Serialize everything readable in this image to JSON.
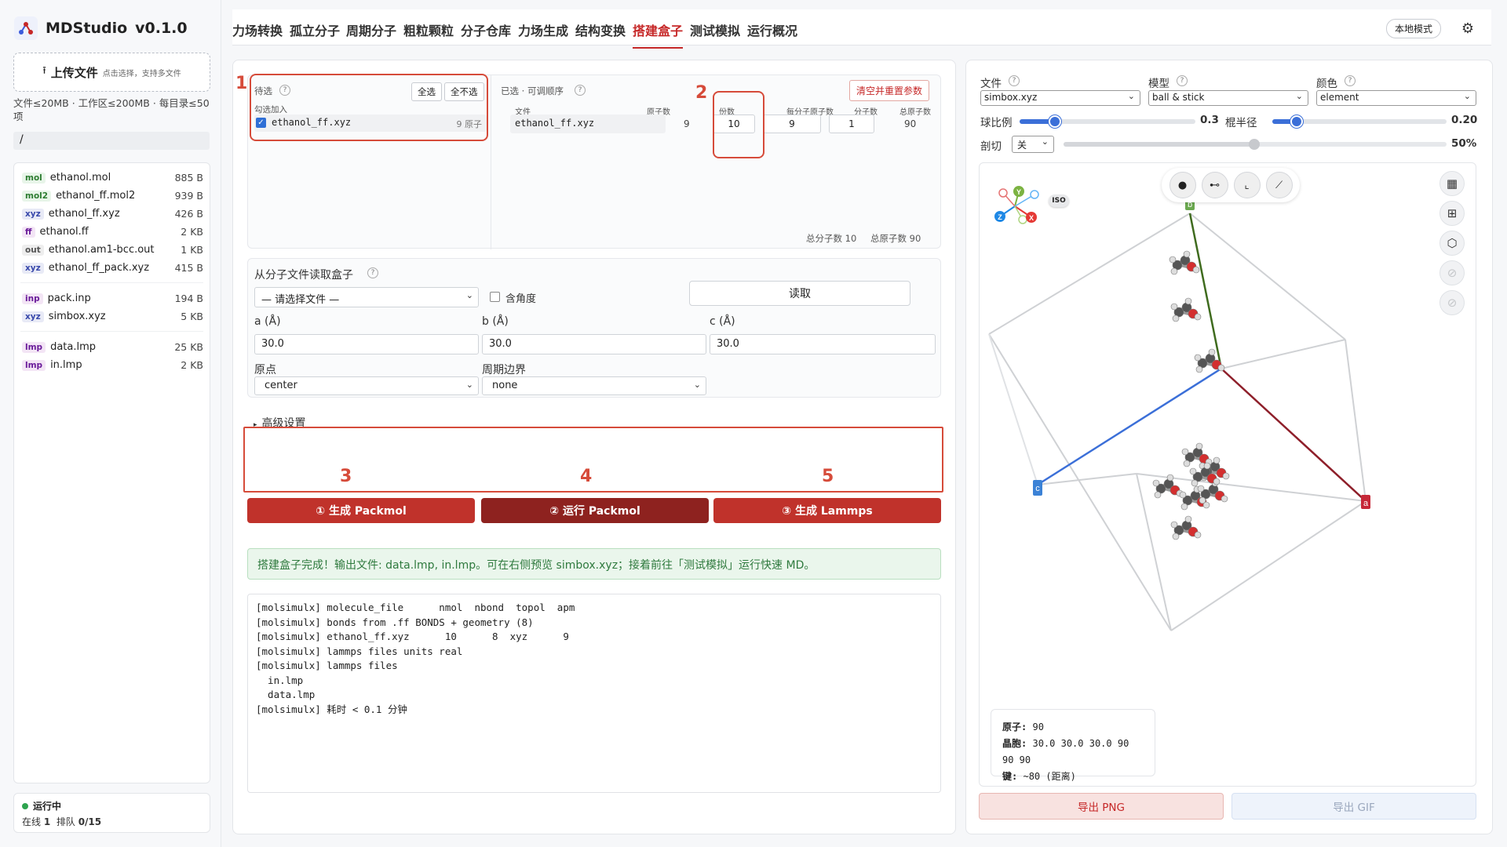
{
  "app": {
    "name": "MDStudio",
    "version": "v0.1.0"
  },
  "sidebar": {
    "upload_label": "上传文件",
    "upload_hint": "点击选择，支持多文件",
    "limits": "文件≤20MB · 工作区≤200MB · 每目录≤50项",
    "path": "/",
    "files": [
      {
        "tag": "mol",
        "name": "ethanol.mol",
        "size": "885 B",
        "color": "#2e7d32",
        "bg": "#e8f5e9"
      },
      {
        "tag": "mol2",
        "name": "ethanol_ff.mol2",
        "size": "939 B",
        "color": "#2e7d32",
        "bg": "#e8f5e9"
      },
      {
        "tag": "xyz",
        "name": "ethanol_ff.xyz",
        "size": "426 B",
        "color": "#3949ab",
        "bg": "#e8eaf6"
      },
      {
        "tag": "ff",
        "name": "ethanol.ff",
        "size": "2 KB",
        "color": "#6a1b9a",
        "bg": "#f3e5f5"
      },
      {
        "tag": "out",
        "name": "ethanol.am1-bcc.out",
        "size": "1 KB",
        "color": "#555555",
        "bg": "#eeeeee"
      },
      {
        "tag": "xyz",
        "name": "ethanol_ff_pack.xyz",
        "size": "415 B",
        "color": "#3949ab",
        "bg": "#e8eaf6"
      },
      {
        "tag": "inp",
        "name": "pack.inp",
        "size": "194 B",
        "color": "#6a1b9a",
        "bg": "#f3e5f5"
      },
      {
        "tag": "xyz",
        "name": "simbox.xyz",
        "size": "5 KB",
        "color": "#3949ab",
        "bg": "#e8eaf6"
      },
      {
        "tag": "lmp",
        "name": "data.lmp",
        "size": "25 KB",
        "color": "#6a1b9a",
        "bg": "#f3e5f5"
      },
      {
        "tag": "lmp",
        "name": "in.lmp",
        "size": "2 KB",
        "color": "#6a1b9a",
        "bg": "#f3e5f5"
      }
    ],
    "status": {
      "state": "运行中",
      "online_label": "在线",
      "online": "1",
      "queue_label": "排队",
      "queue": "0/15"
    }
  },
  "nav": {
    "tabs": [
      "力场转换",
      "孤立分子",
      "周期分子",
      "粗粒颗粒",
      "分子仓库",
      "力场生成",
      "结构变换",
      "搭建盒子",
      "测试模拟",
      "运行概况"
    ],
    "active_index": 7,
    "mode_label": "本地模式"
  },
  "builder": {
    "pending": {
      "title": "待选",
      "select_all": "全选",
      "select_none": "全不选",
      "add_hint": "勾选加入",
      "item_name": "ethanol_ff.xyz",
      "item_atoms": "9 原子",
      "checked": true
    },
    "selected": {
      "title": "已选 · 可调顺序",
      "reset_label": "清空并重置参数",
      "headers": [
        "文件",
        "原子数",
        "份数",
        "每分子原子数",
        "分子数",
        "总原子数"
      ],
      "row": {
        "file": "ethanol_ff.xyz",
        "atoms": "9",
        "copies": "10",
        "atoms_per_mol": "9",
        "mol_count": "1",
        "total_atoms": "90"
      },
      "summary_mols": "总分子数 10",
      "summary_atoms": "总原子数 90"
    },
    "box": {
      "title": "从分子文件读取盒子",
      "file_select": "— 请选择文件 —",
      "include_angle": "含角度",
      "read_label": "读取",
      "a_label": "a (Å)",
      "a_value": "30.0",
      "b_label": "b (Å)",
      "b_value": "30.0",
      "c_label": "c (Å)",
      "c_value": "30.0",
      "origin_label": "原点",
      "origin_value": "center",
      "pbc_label": "周期边界",
      "pbc_value": "none"
    },
    "advanced_label": "高级设置",
    "actions": [
      "① 生成 Packmol",
      "② 运行 Packmol",
      "③ 生成 Lammps"
    ],
    "success_msg": "搭建盒子完成！输出文件: data.lmp, in.lmp。可在右侧预览 simbox.xyz；接着前往「测试模拟」运行快速 MD。",
    "log_lines": [
      "[molsimulx] molecule_file      nmol  nbond  topol  apm",
      "[molsimulx] bonds from .ff BONDS + geometry (8)",
      "[molsimulx] ethanol_ff.xyz      10      8  xyz      9",
      "[molsimulx] lammps files units real",
      "[molsimulx] lammps files",
      "  in.lmp",
      "  data.lmp",
      "[molsimulx] 耗时 < 0.1 分钟"
    ]
  },
  "annotations": [
    "1",
    "2",
    "3",
    "4",
    "5"
  ],
  "viewer": {
    "file_label": "文件",
    "file_value": "simbox.xyz",
    "model_label": "模型",
    "model_value": "ball & stick",
    "color_label": "颜色",
    "color_value": "element",
    "ball_scale_label": "球比例",
    "ball_scale_value": "0.3",
    "stick_radius_label": "棍半径",
    "stick_radius_value": "0.20",
    "clip_label": "剖切",
    "clip_value": "关",
    "clip_percent": "50%",
    "ball_scale_fraction": 0.2,
    "stick_radius_fraction": 0.14,
    "clip_fraction": 0.5,
    "iso_label": "ISO",
    "axis_labels": {
      "a": "a",
      "b": "b",
      "c": "c"
    },
    "gizmo_labels": {
      "x": "X",
      "y": "Y",
      "z": "Z"
    },
    "info": {
      "atoms_label": "原子:",
      "atoms": "90",
      "cell_label": "晶胞:",
      "cell": "30.0 30.0 30.0 90 90 90",
      "bonds_label": "键:",
      "bonds": "~80 (距离)"
    },
    "export_png": "导出 PNG",
    "export_gif": "导出 GIF"
  }
}
